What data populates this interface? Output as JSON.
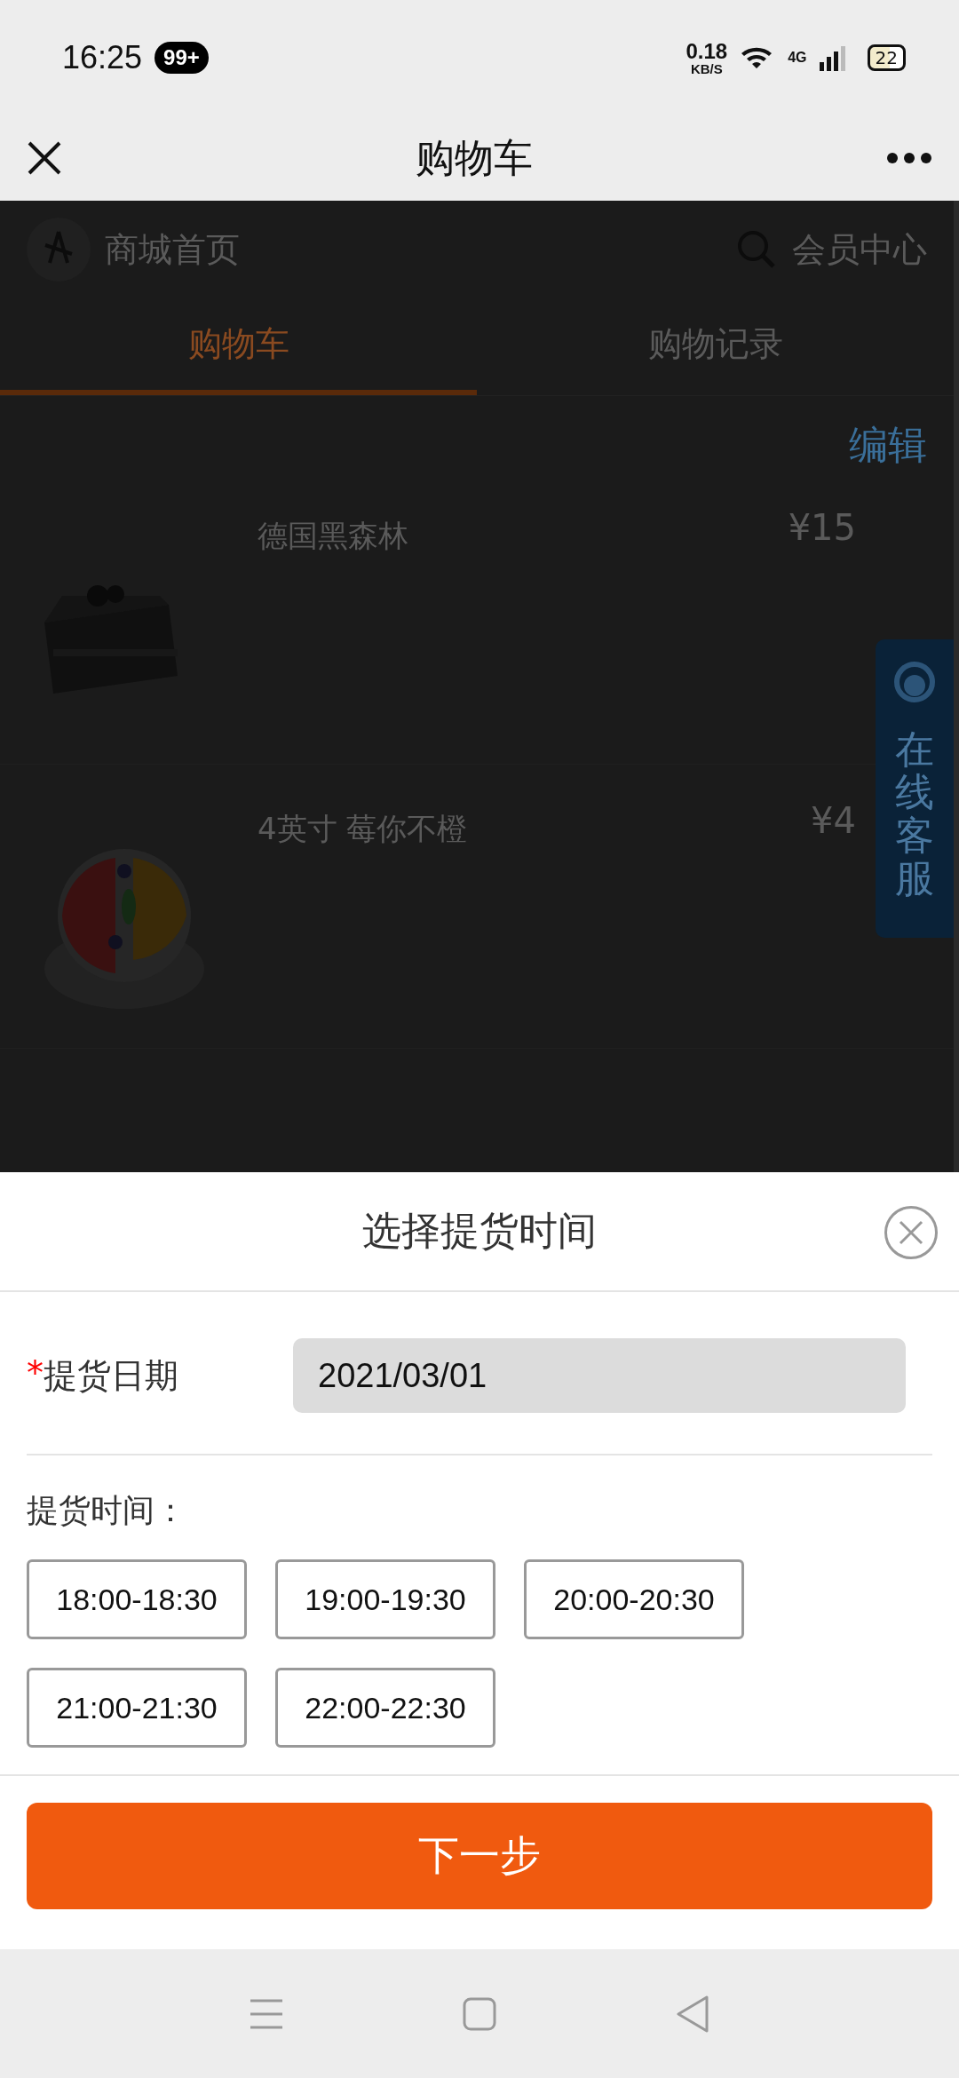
{
  "status_bar": {
    "time": "16:25",
    "badge": "99+",
    "speed_value": "0.18",
    "speed_unit": "KB/S",
    "network": "4G",
    "battery": "22"
  },
  "title_bar": {
    "title": "购物车"
  },
  "page": {
    "home_link": "商城首页",
    "member_link": "会员中心",
    "tabs": [
      {
        "label": "购物车",
        "selected": true
      },
      {
        "label": "购物记录",
        "selected": false
      }
    ],
    "edit": "编辑",
    "items": [
      {
        "name": "德国黑森林",
        "price": "¥15",
        "kind": "chocolate"
      },
      {
        "name": "4英寸 莓你不橙",
        "price": "¥4",
        "kind": "fruit"
      }
    ],
    "service": "在线客服"
  },
  "sheet": {
    "title": "选择提货时间",
    "date_label": "提货日期",
    "required_mark": "*",
    "date_value": "2021/03/01",
    "time_label": "提货时间：",
    "slots": [
      {
        "label": "18:00-18:30",
        "selected": false
      },
      {
        "label": "19:00-19:30",
        "selected": false
      },
      {
        "label": "20:00-20:30",
        "selected": false
      },
      {
        "label": "21:00-21:30",
        "selected": false
      },
      {
        "label": "22:00-22:30",
        "selected": false
      }
    ],
    "next": "下一步"
  }
}
